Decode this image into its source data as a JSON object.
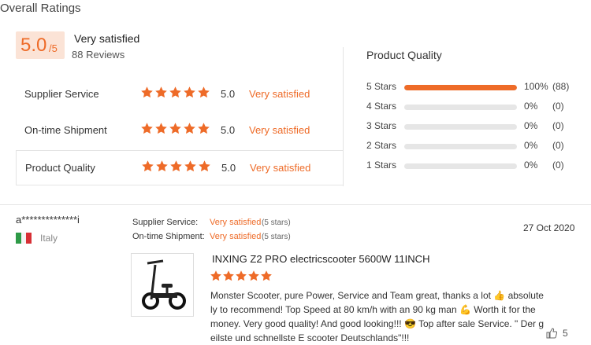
{
  "overall": {
    "title": "Overall Ratings",
    "score": "5.0",
    "score_max": "/5",
    "verdict": "Very satisfied",
    "reviews": "88 Reviews"
  },
  "criteria": [
    {
      "label": "Supplier Service",
      "score": "5.0",
      "verdict": "Very satisfied",
      "stars": 5
    },
    {
      "label": "On-time Shipment",
      "score": "5.0",
      "verdict": "Very satisfied",
      "stars": 5
    },
    {
      "label": "Product Quality",
      "score": "5.0",
      "verdict": "Very satisfied",
      "stars": 5
    }
  ],
  "product_quality": {
    "title": "Product Quality",
    "distribution": [
      {
        "label": "5 Stars",
        "percent": "100%",
        "count": "(88)",
        "fill": 1.0
      },
      {
        "label": "4 Stars",
        "percent": "0%",
        "count": "(0)",
        "fill": 0
      },
      {
        "label": "3 Stars",
        "percent": "0%",
        "count": "(0)",
        "fill": 0
      },
      {
        "label": "2 Stars",
        "percent": "0%",
        "count": "(0)",
        "fill": 0
      },
      {
        "label": "1 Stars",
        "percent": "0%",
        "count": "(0)",
        "fill": 0
      }
    ]
  },
  "review": {
    "user": "a**************i",
    "country": "Italy",
    "supplier_label": "Supplier Service:",
    "supplier_value": "Very satisfied",
    "supplier_stars": "(5 stars)",
    "shipment_label": "On-time Shipment:",
    "shipment_value": "Very satisfied",
    "shipment_stars": "(5 stars)",
    "date": "27 Oct 2020",
    "product": "INXING Z2 PRO electricscooter 5600W 11INCH",
    "rating": 5,
    "text": "Monster Scooter, pure Power, Service and Team great, thanks a lot 👍 absolutely to recommend! Top Speed at 80 km/h with an 90 kg man 💪 Worth it for the money. Very good quality! And good looking!!! 😎 Top after sale Service. \" Der geilste und schnellste E scooter Deutschlands\"!!!",
    "likes": "5"
  },
  "colors": {
    "accent": "#ee6b28",
    "score_bg": "#fbe3d6",
    "track": "#e6e6e6"
  },
  "icons": {
    "star": "star-icon",
    "flag": "italy-flag-icon",
    "like": "thumbs-up-icon",
    "product": "scooter-image"
  }
}
